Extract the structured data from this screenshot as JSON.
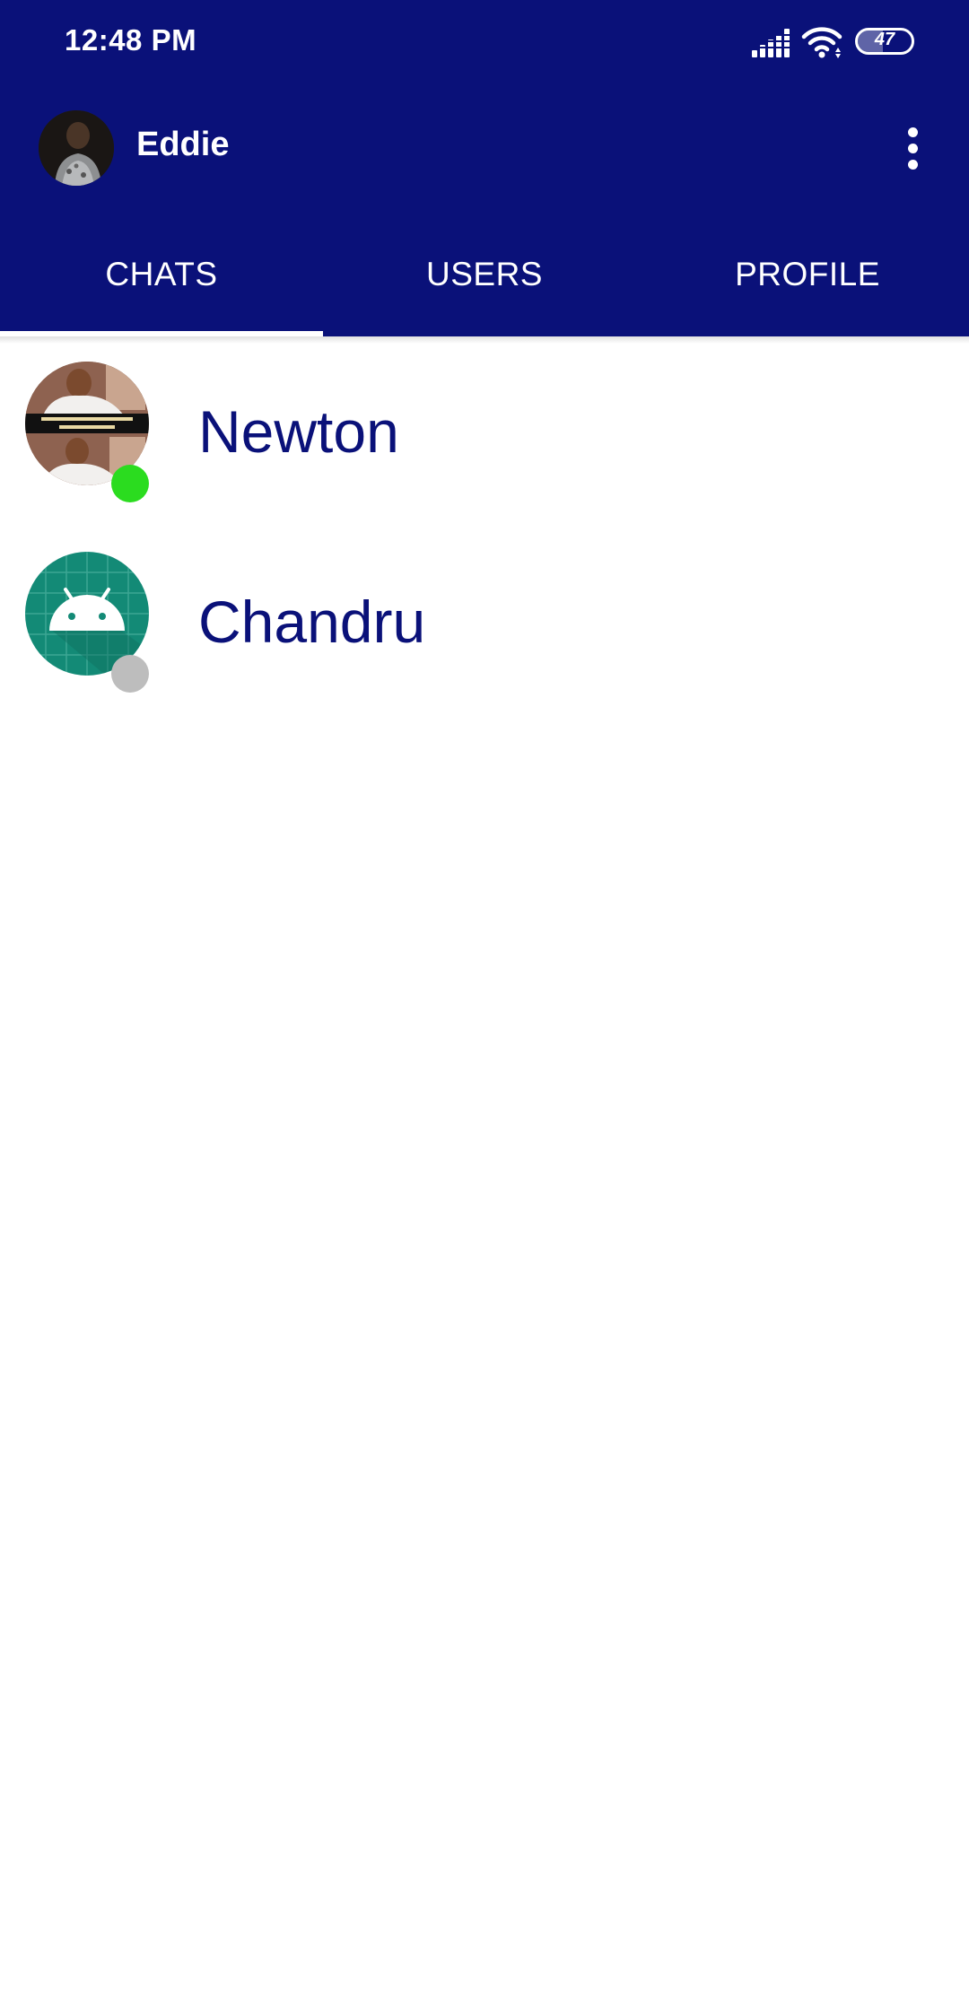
{
  "status_bar": {
    "time": "12:48 PM",
    "battery_level": 47,
    "battery_text": "47",
    "signal_icon": "cellular-signal-icon",
    "wifi_icon": "wifi-icon"
  },
  "toolbar": {
    "user_name": "Eddie",
    "menu_icon": "more-vert-icon"
  },
  "tabs": [
    {
      "label": "CHATS",
      "selected": true
    },
    {
      "label": "USERS",
      "selected": false
    },
    {
      "label": "PROFILE",
      "selected": false
    }
  ],
  "chats": [
    {
      "name": "Newton",
      "online": true,
      "avatar": "photo"
    },
    {
      "name": "Chandru",
      "online": false,
      "avatar": "android-default"
    }
  ],
  "colors": {
    "primary": "#0a1179",
    "online": "#2bdc1f",
    "offline": "#bdbdbd",
    "android_avatar_bg": "#138a76"
  }
}
